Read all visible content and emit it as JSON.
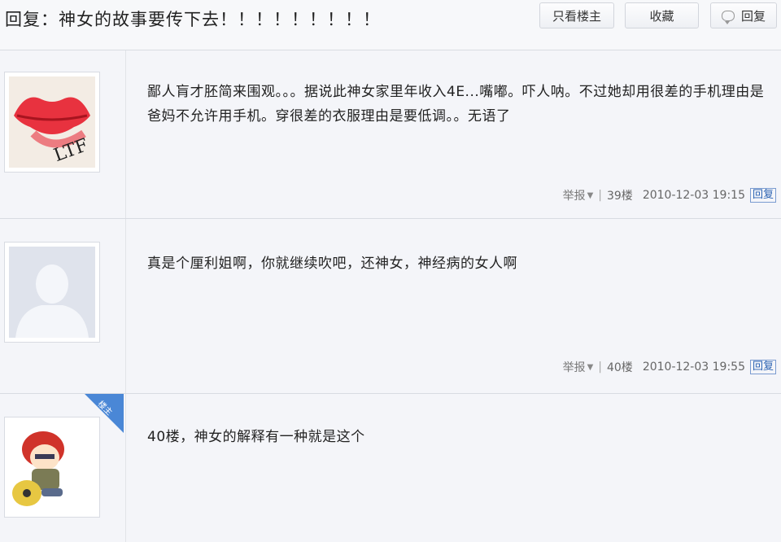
{
  "header": {
    "title": "回复：神女的故事要传下去！！！！！！！！！",
    "only_author_label": "只看楼主",
    "favorite_label": "收藏",
    "reply_label": "回复"
  },
  "posts": [
    {
      "avatar": "lips-icon",
      "text": "鄙人肓才胚简来围观。。。据说此神女家里年收入4E...嘴嘟。吓人呐。不过她却用很差的手机理由是爸妈不允许用手机。穿很差的衣服理由是要低调。。无语了",
      "report_label": "举报",
      "floor": "39楼",
      "time": "2010-12-03 19:15",
      "reply_label": "回复"
    },
    {
      "avatar": "default-user-icon",
      "text": "真是个厘利姐啊，你就继续吹吧，还神女，神经病的女人啊",
      "report_label": "举报",
      "floor": "40楼",
      "time": "2010-12-03 19:55",
      "reply_label": "回复"
    },
    {
      "avatar": "cartoon-boy-icon",
      "author_badge": "楼主",
      "text": "40楼，神女的解释有一种就是这个"
    }
  ],
  "colors": {
    "background": "#f4f5f9",
    "link": "#2d64b3",
    "author_badge": "#4a87d6"
  }
}
